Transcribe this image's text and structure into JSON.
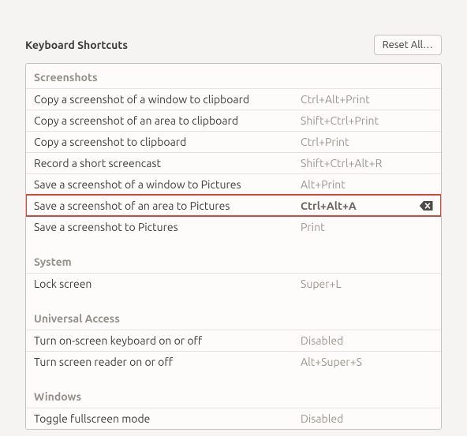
{
  "header": {
    "title": "Keyboard Shortcuts",
    "reset_label": "Reset All…"
  },
  "sections": {
    "screenshots": {
      "title": "Screenshots",
      "items": [
        {
          "label": "Copy a screenshot of a window to clipboard",
          "accel": "Ctrl+Alt+Print"
        },
        {
          "label": "Copy a screenshot of an area to clipboard",
          "accel": "Shift+Ctrl+Print"
        },
        {
          "label": "Copy a screenshot to clipboard",
          "accel": "Ctrl+Print"
        },
        {
          "label": "Record a short screencast",
          "accel": "Shift+Ctrl+Alt+R"
        },
        {
          "label": "Save a screenshot of a window to Pictures",
          "accel": "Alt+Print"
        },
        {
          "label": "Save a screenshot of an area to Pictures",
          "accel": "Ctrl+Alt+A",
          "highlighted": true
        },
        {
          "label": "Save a screenshot to Pictures",
          "accel": "Print"
        }
      ]
    },
    "system": {
      "title": "System",
      "items": [
        {
          "label": "Lock screen",
          "accel": "Super+L"
        }
      ]
    },
    "universal": {
      "title": "Universal Access",
      "items": [
        {
          "label": "Turn on-screen keyboard on or off",
          "accel": "Disabled"
        },
        {
          "label": "Turn screen reader on or off",
          "accel": "Alt+Super+S"
        }
      ]
    },
    "windows": {
      "title": "Windows",
      "items": [
        {
          "label": "Toggle fullscreen mode",
          "accel": "Disabled"
        }
      ]
    }
  }
}
